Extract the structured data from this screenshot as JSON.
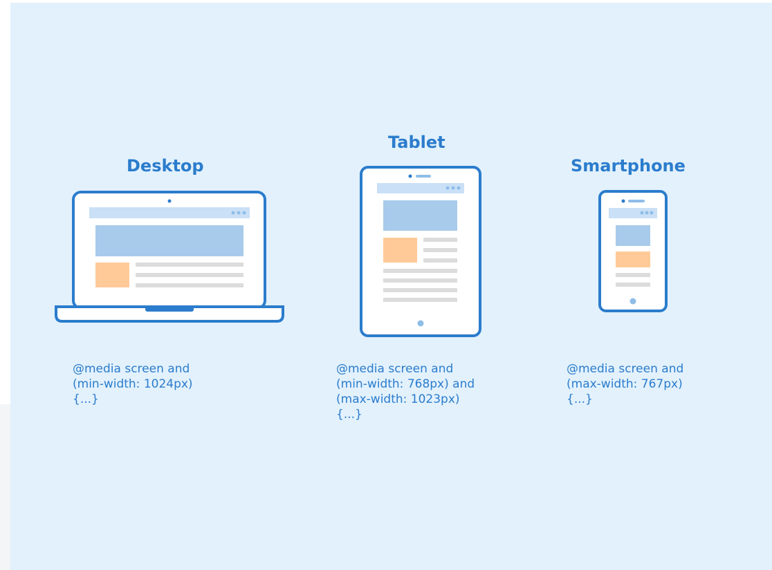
{
  "accent_color": "#2b7ccc",
  "background_color": "#e2f1fc",
  "devices": [
    {
      "title": "Desktop",
      "icon": "laptop-icon",
      "media_query": [
        "@media screen and",
        "(min-width: 1024px)",
        "{...}"
      ]
    },
    {
      "title": "Tablet",
      "icon": "tablet-icon",
      "media_query": [
        "@media screen and",
        "(min-width: 768px) and",
        "(max-width: 1023px)",
        "{...}"
      ]
    },
    {
      "title": "Smartphone",
      "icon": "smartphone-icon",
      "media_query": [
        "@media screen and",
        "(max-width: 767px)",
        "{...}"
      ]
    }
  ]
}
